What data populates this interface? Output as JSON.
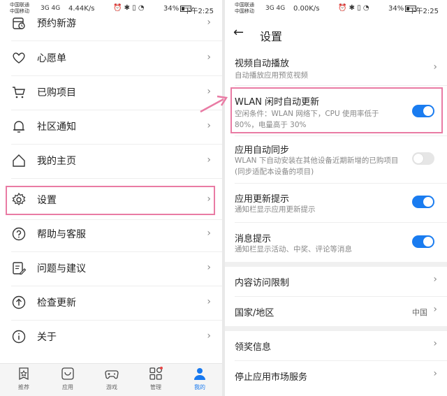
{
  "left": {
    "status": {
      "carrier1": "中国联通",
      "carrier2": "中国移动",
      "signal": "3G 4G",
      "speed": "4.44K/s",
      "battery": "34%",
      "time": "下午2:25"
    },
    "menu": [
      {
        "label": "预约新游",
        "icon": "calendar-icon"
      },
      {
        "label": "心愿单",
        "icon": "heart-icon"
      },
      {
        "label": "已购项目",
        "icon": "cart-icon"
      },
      {
        "label": "社区通知",
        "icon": "bell-icon"
      },
      {
        "label": "我的主页",
        "icon": "home-icon"
      },
      {
        "label": "设置",
        "icon": "gear-icon"
      },
      {
        "label": "帮助与客服",
        "icon": "help-icon"
      },
      {
        "label": "问题与建议",
        "icon": "feedback-icon"
      },
      {
        "label": "检查更新",
        "icon": "upload-icon"
      },
      {
        "label": "关于",
        "icon": "info-icon"
      }
    ],
    "nav": [
      {
        "label": "推荐",
        "icon": "star-icon"
      },
      {
        "label": "应用",
        "icon": "app-icon"
      },
      {
        "label": "游戏",
        "icon": "gamepad-icon"
      },
      {
        "label": "管理",
        "icon": "grid-icon"
      },
      {
        "label": "我的",
        "icon": "person-icon"
      }
    ],
    "accent": "#1879ef"
  },
  "right": {
    "status": {
      "carrier1": "中国联通",
      "carrier2": "中国移动",
      "signal": "3G 4G",
      "speed": "0.00K/s",
      "battery": "34%",
      "time": "下午2:25"
    },
    "title": "设置",
    "rows": [
      {
        "title": "视频自动播放",
        "sub": "自动播放应用预览视频"
      },
      {
        "title": "WLAN 闲时自动更新",
        "sub": "空闲条件：WLAN 网络下，CPU 使用率低于 80%，电量高于 30%",
        "toggle": true
      },
      {
        "title": "应用自动同步",
        "sub": "WLAN 下自动安装在其他设备近期新增的已购项目 (同步适配本设备的项目)",
        "toggle": false
      },
      {
        "title": "应用更新提示",
        "sub": "通知栏显示应用更新提示",
        "toggle": true
      },
      {
        "title": "消息提示",
        "sub": "通知栏显示活动、中奖、评论等消息",
        "toggle": true
      },
      {
        "title": "内容访问限制"
      },
      {
        "title": "国家/地区",
        "value": "中国"
      },
      {
        "title": "领奖信息"
      },
      {
        "title": "停止应用市场服务"
      }
    ],
    "highlight_color": "#e97ba4"
  }
}
